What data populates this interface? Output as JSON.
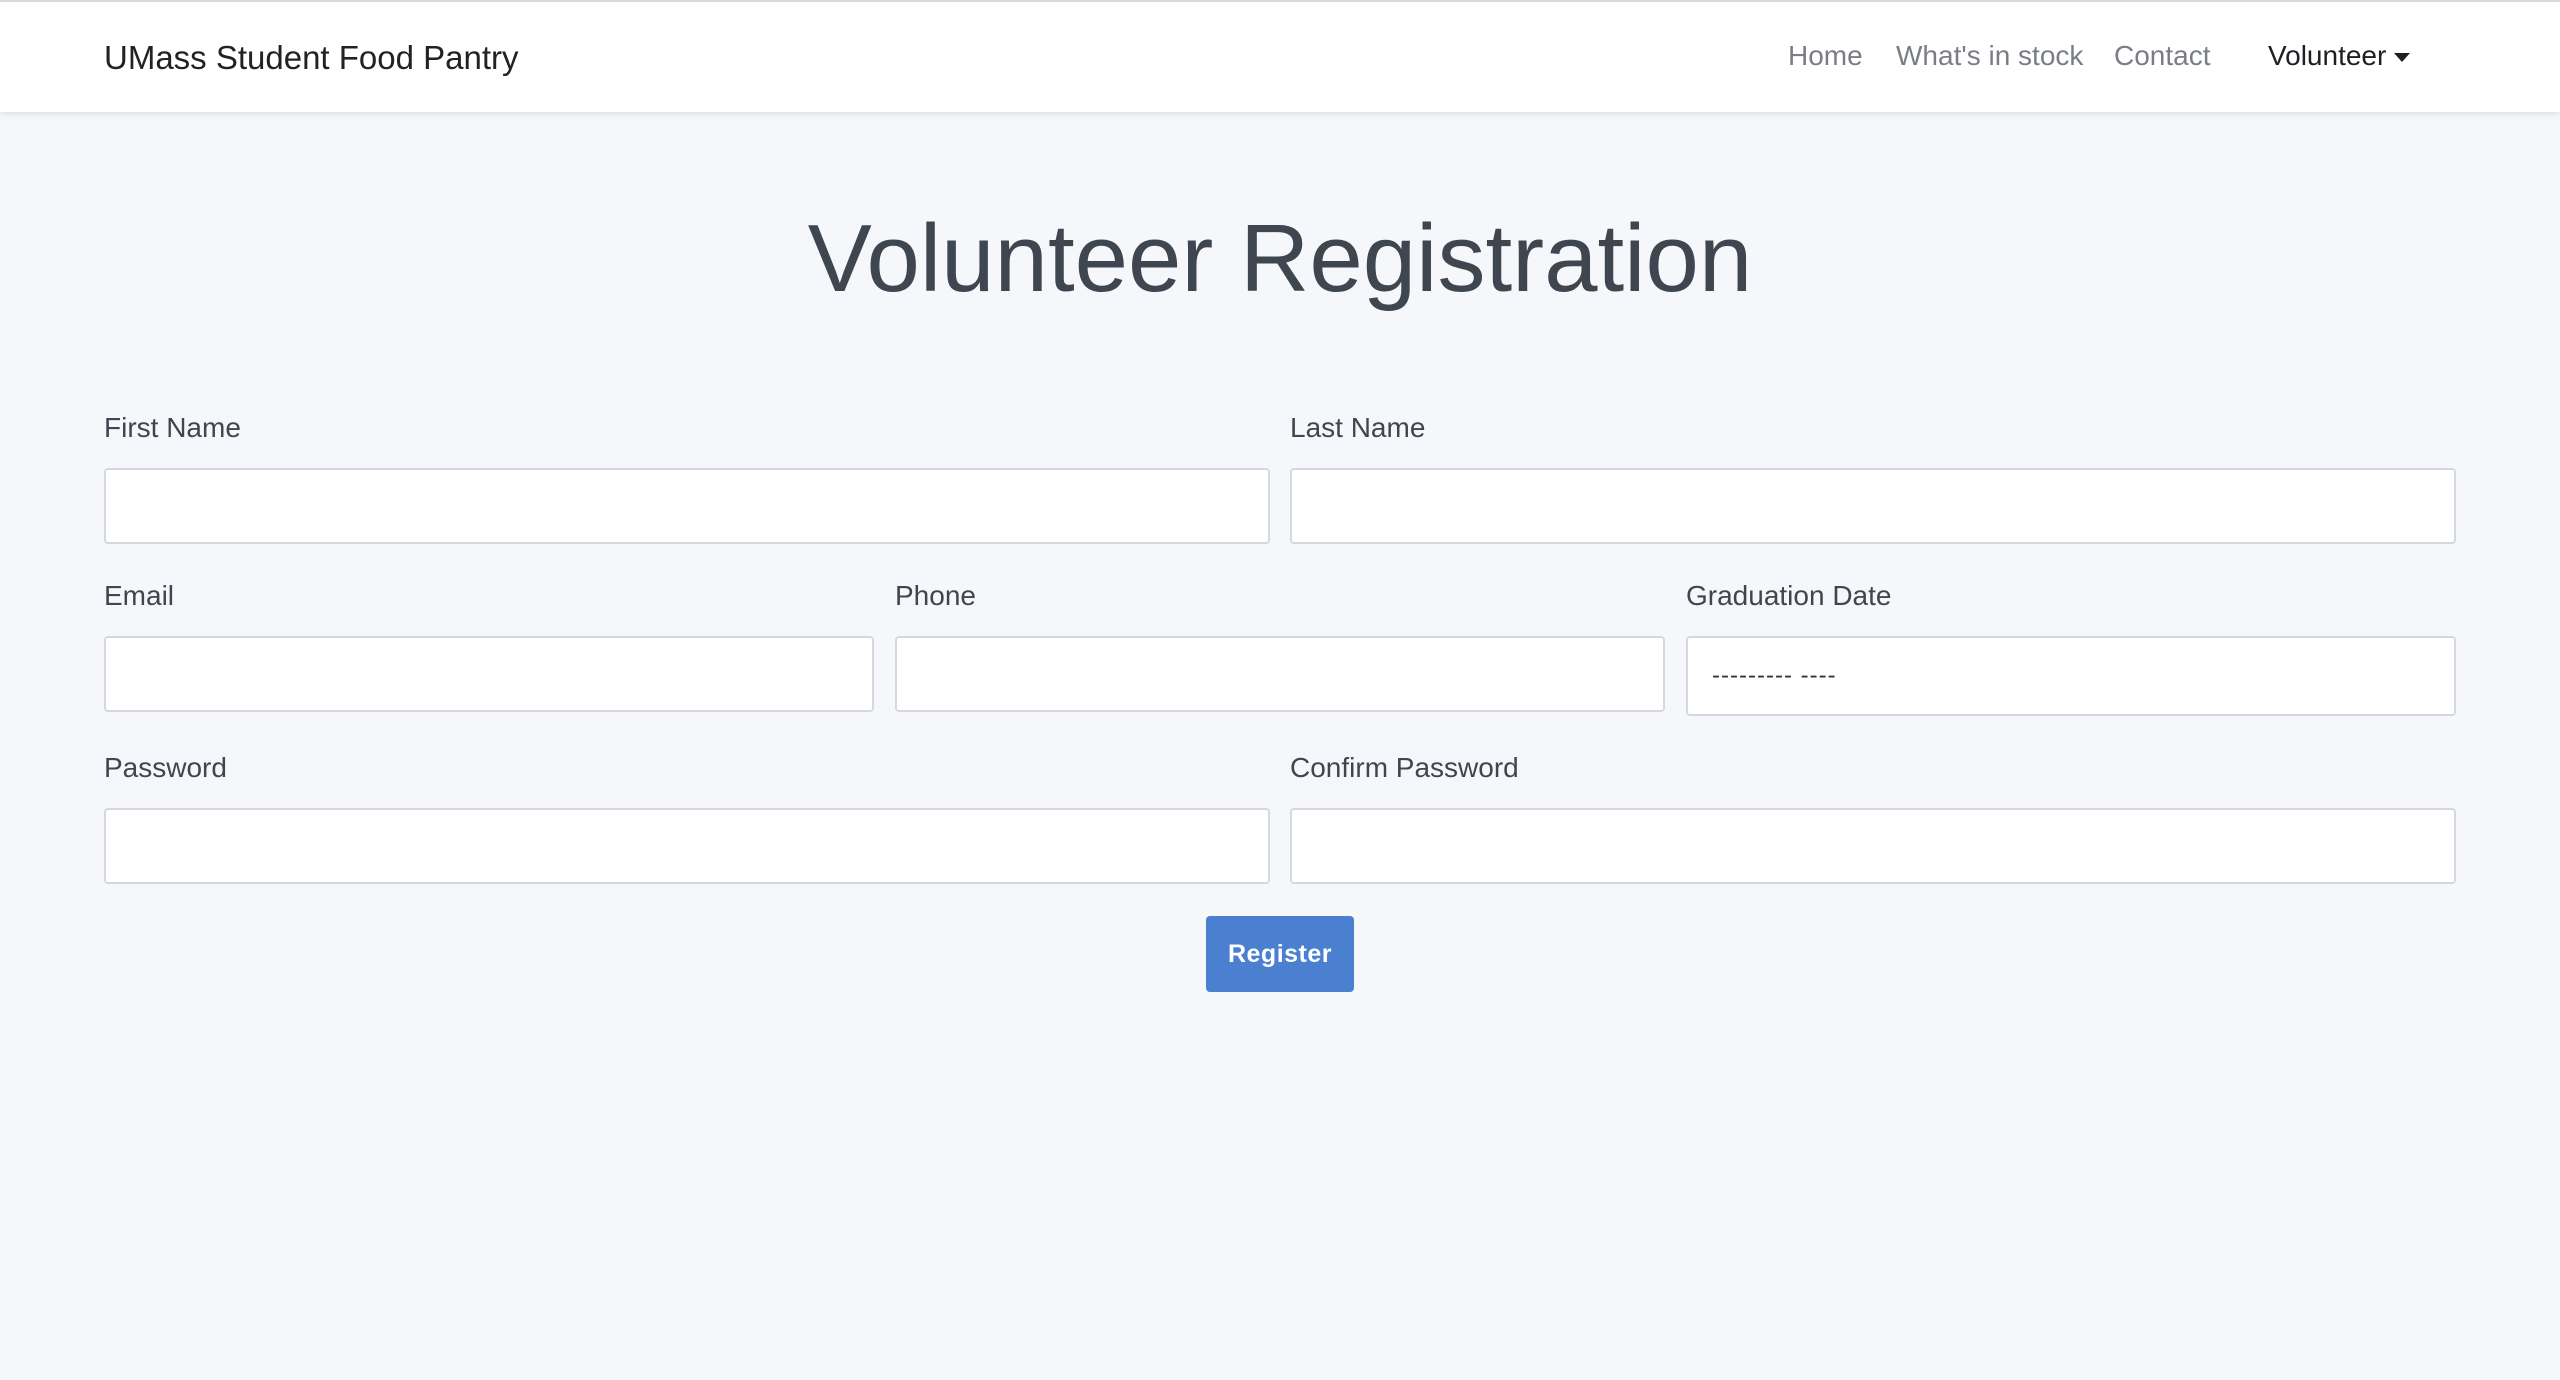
{
  "navbar": {
    "brand": "UMass Student Food Pantry",
    "links": {
      "home": "Home",
      "stock": "What's in stock",
      "contact": "Contact"
    },
    "dropdown": "Volunteer"
  },
  "page": {
    "title": "Volunteer Registration"
  },
  "form": {
    "first_name": {
      "label": "First Name",
      "value": ""
    },
    "last_name": {
      "label": "Last Name",
      "value": ""
    },
    "email": {
      "label": "Email",
      "value": ""
    },
    "phone": {
      "label": "Phone",
      "value": ""
    },
    "graduation_date": {
      "label": "Graduation Date",
      "placeholder": "--------- ----"
    },
    "password": {
      "label": "Password",
      "value": ""
    },
    "confirm_password": {
      "label": "Confirm Password",
      "value": ""
    },
    "submit_label": "Register"
  },
  "colors": {
    "background": "#f5f7fb",
    "navbar": "#ffffff",
    "primary_button": "#4a80cf"
  }
}
